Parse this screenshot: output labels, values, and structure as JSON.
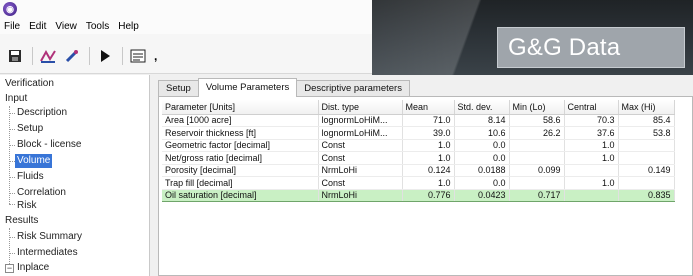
{
  "banner": {
    "title": "G&G Data"
  },
  "menu": [
    "File",
    "Edit",
    "View",
    "Tools",
    "Help"
  ],
  "toolbar": {
    "icons": [
      "save-icon",
      "chart-icon",
      "tools-icon",
      "run-icon",
      "report-icon",
      "more-icon"
    ],
    "more_label": ","
  },
  "nav": {
    "verification": "Verification",
    "input": "Input",
    "input_items": [
      "Description",
      "Setup",
      "Block - license",
      "Volume",
      "Fluids",
      "Correlation",
      "Risk"
    ],
    "results": "Results",
    "results_items": [
      "Risk Summary",
      "Intermediates"
    ],
    "inplace": "Inplace",
    "expander_minus": "−",
    "selected": "Volume"
  },
  "tabs": [
    "Setup",
    "Volume Parameters",
    "Descriptive parameters"
  ],
  "active_tab": "Volume Parameters",
  "grid": {
    "columns": [
      "Parameter [Units]",
      "Dist. type",
      "Mean",
      "Std. dev.",
      "Min (Lo)",
      "Central",
      "Max (Hi)"
    ],
    "rows": [
      [
        "Area [1000 acre]",
        "lognormLoHiM...",
        "71.0",
        "8.14",
        "58.6",
        "70.3",
        "85.4"
      ],
      [
        "Reservoir thickness [ft]",
        "lognormLoHiM...",
        "39.0",
        "10.6",
        "26.2",
        "37.6",
        "53.8"
      ],
      [
        "Geometric factor [decimal]",
        "Const",
        "1.0",
        "0.0",
        "",
        "1.0",
        ""
      ],
      [
        "Net/gross ratio [decimal]",
        "Const",
        "1.0",
        "0.0",
        "",
        "1.0",
        ""
      ],
      [
        "Porosity [decimal]",
        "NrmLoHi",
        "0.124",
        "0.0188",
        "0.099",
        "",
        "0.149"
      ],
      [
        "Trap fill [decimal]",
        "Const",
        "1.0",
        "0.0",
        "",
        "1.0",
        ""
      ],
      [
        "Oil saturation [decimal]",
        "NrmLoHi",
        "0.776",
        "0.0423",
        "0.717",
        "",
        "0.835"
      ]
    ],
    "highlighted_row": 6
  },
  "colors": {
    "selection": "#3875d7",
    "highlight_row": "#c9f0c4",
    "banner": "#2b3136"
  }
}
